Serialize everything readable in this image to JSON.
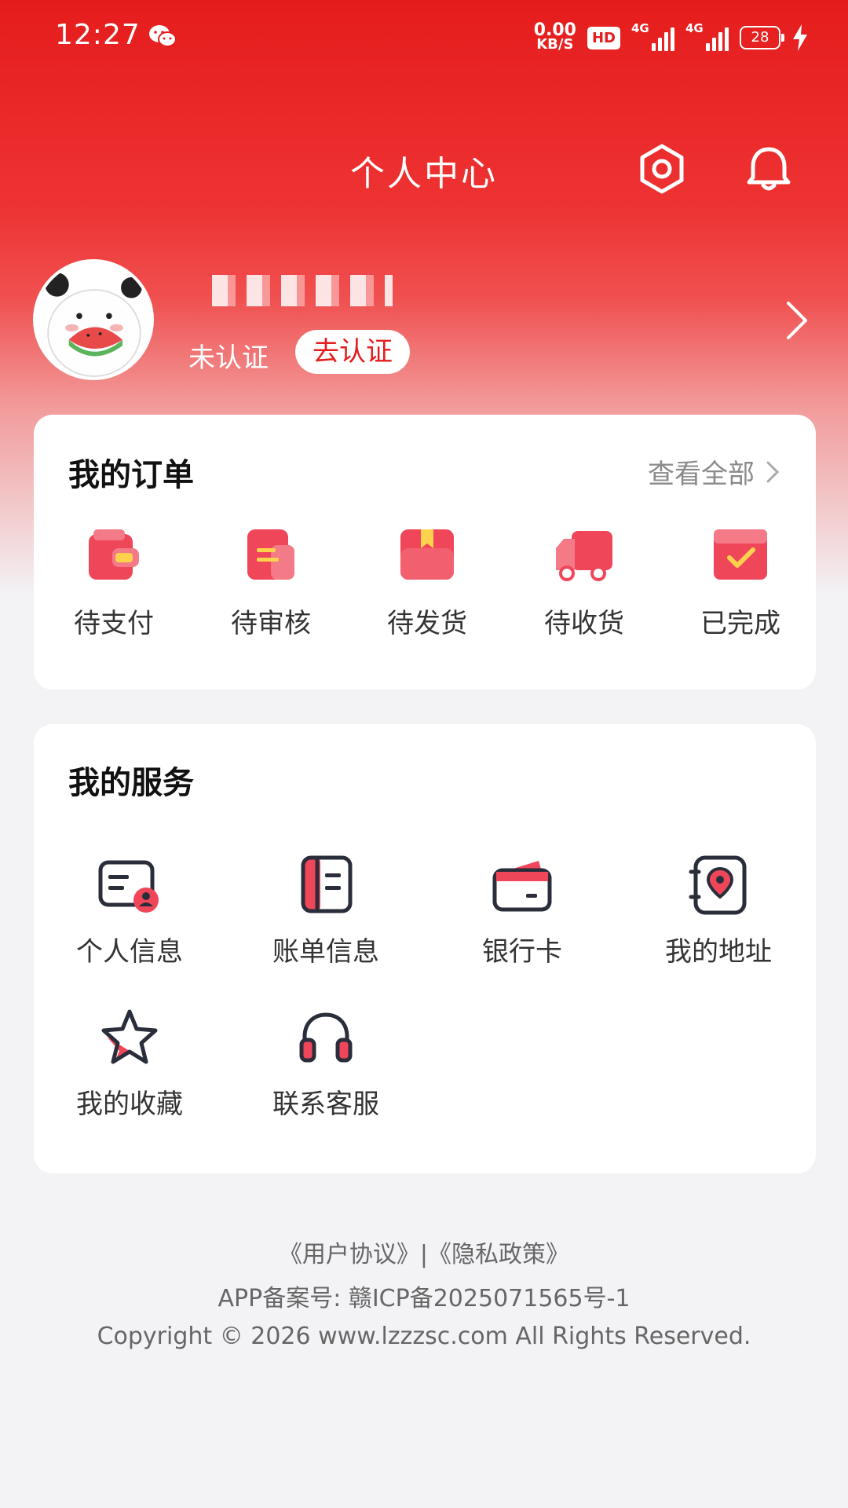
{
  "status_bar": {
    "time": "12:27",
    "net_speed_value": "0.00",
    "net_speed_unit": "KB/S",
    "hd_label": "HD",
    "signal1_label": "4G",
    "signal2_label": "4G",
    "battery": "28"
  },
  "header": {
    "title": "个人中心",
    "settings_icon": "settings-gear-icon",
    "bell_icon": "notification-bell-icon"
  },
  "profile": {
    "status_text": "未认证",
    "verify_button": "去认证"
  },
  "orders": {
    "title": "我的订单",
    "view_all": "查看全部",
    "items": [
      {
        "label": "待支付",
        "icon": "wallet-icon"
      },
      {
        "label": "待审核",
        "icon": "document-icon"
      },
      {
        "label": "待发货",
        "icon": "box-icon"
      },
      {
        "label": "待收货",
        "icon": "truck-icon"
      },
      {
        "label": "已完成",
        "icon": "check-box-icon"
      }
    ]
  },
  "services": {
    "title": "我的服务",
    "items": [
      {
        "label": "个人信息",
        "icon": "id-card-icon"
      },
      {
        "label": "账单信息",
        "icon": "bill-book-icon"
      },
      {
        "label": "银行卡",
        "icon": "bank-card-icon"
      },
      {
        "label": "我的地址",
        "icon": "address-book-icon"
      },
      {
        "label": "我的收藏",
        "icon": "star-icon"
      },
      {
        "label": "联系客服",
        "icon": "headset-icon"
      }
    ]
  },
  "footer": {
    "links": "《用户协议》|《隐私政策》",
    "icp": "APP备案号: 赣ICP备2025071565号-1",
    "copyright": "Copyright © 2026 www.lzzzsc.com All Rights Reserved."
  },
  "colors": {
    "brand_red": "#e51c1c",
    "icon_red": "#f0465a",
    "background": "#f3f3f6"
  }
}
